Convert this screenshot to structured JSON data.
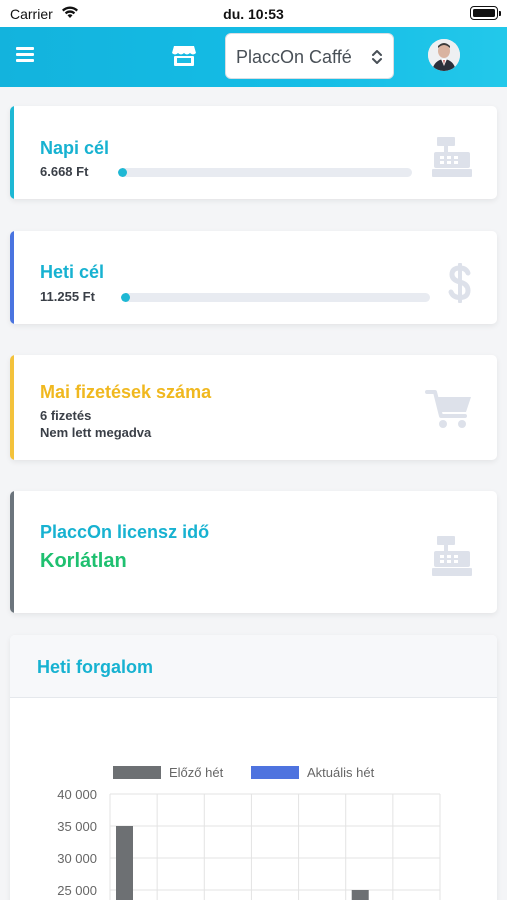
{
  "status_bar": {
    "carrier": "Carrier",
    "time": "du. 10:53"
  },
  "navbar": {
    "shop_name": "PlaccOn Caffé"
  },
  "cards": {
    "daily": {
      "title": "Napi cél",
      "amount": "6.668 Ft",
      "progress": 0.03
    },
    "weekly": {
      "title": "Heti cél",
      "amount": "11.255 Ft",
      "progress": 0.01
    },
    "payments": {
      "title": "Mai fizetések száma",
      "count": "6 fizetés",
      "note": "Nem lett megadva"
    },
    "license": {
      "title": "PlaccOn licensz idő",
      "value": "Korlátlan"
    }
  },
  "colors": {
    "accent_cyan": "#1eb8d4",
    "accent_blue": "#4a74e0",
    "accent_yellow": "#f3c23b",
    "accent_gray": "#6c757d",
    "license_green": "#1fc070",
    "icon_gray": "#dde1ea"
  },
  "icons": {
    "menu": "hamburger-icon",
    "store": "store-icon",
    "daily": "cash-register-icon",
    "weekly": "dollar-icon",
    "payments": "cart-icon",
    "license": "cash-register-icon"
  },
  "chart_section": {
    "title": "Heti forgalom"
  },
  "chart_data": {
    "type": "bar",
    "title": "",
    "legend": [
      {
        "name": "Előző hét",
        "color": "#6d7073"
      },
      {
        "name": "Aktuális hét",
        "color": "#4e73df"
      }
    ],
    "y_ticks": [
      "40 000",
      "35 000",
      "30 000",
      "25 000"
    ],
    "ylim_visible": [
      25000,
      40000
    ],
    "categories_count": 7,
    "series": [
      {
        "name": "Előző hét",
        "values": [
          35000,
          null,
          null,
          null,
          null,
          25000,
          null
        ]
      },
      {
        "name": "Aktuális hét",
        "values": [
          null,
          null,
          null,
          null,
          null,
          null,
          null
        ]
      }
    ]
  }
}
